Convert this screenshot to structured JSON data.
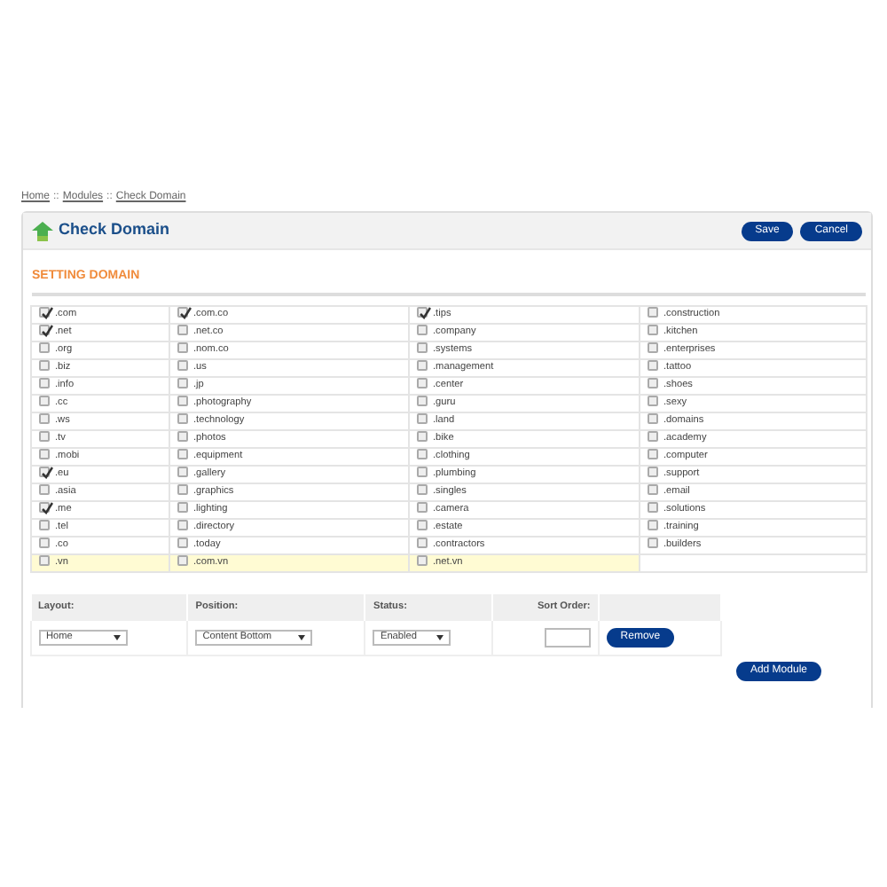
{
  "breadcrumb": {
    "items": [
      "Home",
      "Modules",
      "Check Domain"
    ],
    "separator": "::"
  },
  "panel": {
    "title": "Check Domain",
    "buttons": [
      "Save",
      "Cancel"
    ]
  },
  "section_title": "SETTING DOMAIN",
  "domain_rows": [
    {
      "highlighted": false,
      "cells": [
        {
          "label": ".com",
          "checked": true
        },
        {
          "label": ".com.co",
          "checked": true
        },
        {
          "label": ".tips",
          "checked": true
        },
        {
          "label": ".construction",
          "checked": false
        }
      ]
    },
    {
      "highlighted": false,
      "cells": [
        {
          "label": ".net",
          "checked": true
        },
        {
          "label": ".net.co",
          "checked": false
        },
        {
          "label": ".company",
          "checked": false
        },
        {
          "label": ".kitchen",
          "checked": false
        }
      ]
    },
    {
      "highlighted": false,
      "cells": [
        {
          "label": ".org",
          "checked": false
        },
        {
          "label": ".nom.co",
          "checked": false
        },
        {
          "label": ".systems",
          "checked": false
        },
        {
          "label": ".enterprises",
          "checked": false
        }
      ]
    },
    {
      "highlighted": false,
      "cells": [
        {
          "label": ".biz",
          "checked": false
        },
        {
          "label": ".us",
          "checked": false
        },
        {
          "label": ".management",
          "checked": false
        },
        {
          "label": ".tattoo",
          "checked": false
        }
      ]
    },
    {
      "highlighted": false,
      "cells": [
        {
          "label": ".info",
          "checked": false
        },
        {
          "label": ".jp",
          "checked": false
        },
        {
          "label": ".center",
          "checked": false
        },
        {
          "label": ".shoes",
          "checked": false
        }
      ]
    },
    {
      "highlighted": false,
      "cells": [
        {
          "label": ".cc",
          "checked": false
        },
        {
          "label": ".photography",
          "checked": false
        },
        {
          "label": ".guru",
          "checked": false
        },
        {
          "label": ".sexy",
          "checked": false
        }
      ]
    },
    {
      "highlighted": false,
      "cells": [
        {
          "label": ".ws",
          "checked": false
        },
        {
          "label": ".technology",
          "checked": false
        },
        {
          "label": ".land",
          "checked": false
        },
        {
          "label": ".domains",
          "checked": false
        }
      ]
    },
    {
      "highlighted": false,
      "cells": [
        {
          "label": ".tv",
          "checked": false
        },
        {
          "label": ".photos",
          "checked": false
        },
        {
          "label": ".bike",
          "checked": false
        },
        {
          "label": ".academy",
          "checked": false
        }
      ]
    },
    {
      "highlighted": false,
      "cells": [
        {
          "label": ".mobi",
          "checked": false
        },
        {
          "label": ".equipment",
          "checked": false
        },
        {
          "label": ".clothing",
          "checked": false
        },
        {
          "label": ".computer",
          "checked": false
        }
      ]
    },
    {
      "highlighted": false,
      "cells": [
        {
          "label": ".eu",
          "checked": true
        },
        {
          "label": ".gallery",
          "checked": false
        },
        {
          "label": ".plumbing",
          "checked": false
        },
        {
          "label": ".support",
          "checked": false
        }
      ]
    },
    {
      "highlighted": false,
      "cells": [
        {
          "label": ".asia",
          "checked": false
        },
        {
          "label": ".graphics",
          "checked": false
        },
        {
          "label": ".singles",
          "checked": false
        },
        {
          "label": ".email",
          "checked": false
        }
      ]
    },
    {
      "highlighted": false,
      "cells": [
        {
          "label": ".me",
          "checked": true
        },
        {
          "label": ".lighting",
          "checked": false
        },
        {
          "label": ".camera",
          "checked": false
        },
        {
          "label": ".solutions",
          "checked": false
        }
      ]
    },
    {
      "highlighted": false,
      "cells": [
        {
          "label": ".tel",
          "checked": false
        },
        {
          "label": ".directory",
          "checked": false
        },
        {
          "label": ".estate",
          "checked": false
        },
        {
          "label": ".training",
          "checked": false
        }
      ]
    },
    {
      "highlighted": false,
      "cells": [
        {
          "label": ".co",
          "checked": false
        },
        {
          "label": ".today",
          "checked": false
        },
        {
          "label": ".contractors",
          "checked": false
        },
        {
          "label": ".builders",
          "checked": false
        }
      ]
    },
    {
      "highlighted": true,
      "cells": [
        {
          "label": ".vn",
          "checked": false
        },
        {
          "label": ".com.vn",
          "checked": false
        },
        {
          "label": ".net.vn",
          "checked": false
        }
      ]
    }
  ],
  "module_table": {
    "columns": [
      "Layout:",
      "Position:",
      "Status:",
      "Sort Order:"
    ],
    "rows": [
      {
        "layout": "Home",
        "position": "Content Bottom",
        "status": "Enabled",
        "remove_button": "Remove"
      }
    ],
    "add_button": "Add Module"
  }
}
